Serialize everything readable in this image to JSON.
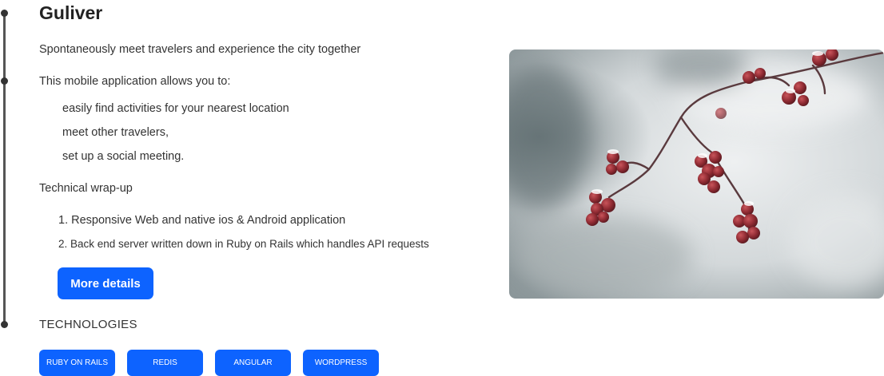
{
  "project": {
    "title": "Guliver",
    "tagline": "Spontaneously meet travelers and experience the city together",
    "intro": "This mobile application allows you to:",
    "features": [
      "easily find activities for your nearest location",
      "meet other travelers,",
      "set up a social meeting."
    ],
    "tech_heading": "Technical wrap-up",
    "tech_points": [
      "1. Responsive Web and native ios & Android application",
      "2. Back end server written down in Ruby on Rails which handles API requests"
    ],
    "more_button": "More details"
  },
  "technologies": {
    "heading": "TECHNOLOGIES",
    "tags": [
      "RUBY ON RAILS",
      "REDIS",
      "ANGULAR",
      "WORDPRESS"
    ]
  },
  "colors": {
    "accent": "#0d63ff",
    "timeline": "#555555"
  }
}
